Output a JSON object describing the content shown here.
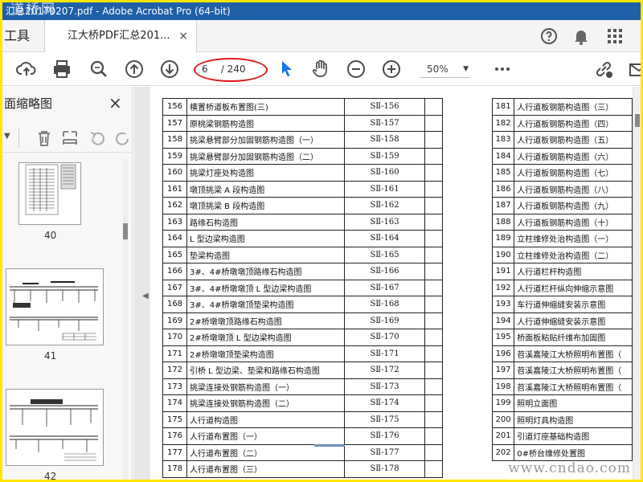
{
  "window": {
    "title": "汇总20170207.pdf - Adobe Acrobat Pro (64-bit)",
    "watermark": "道桥网"
  },
  "tabs": {
    "tools_label": "工具",
    "doc_label": "江大桥PDF汇总201...",
    "close": "×"
  },
  "toolbar": {
    "page_current": "6",
    "page_total": "/ 240",
    "zoom_value": "50%"
  },
  "left_panel": {
    "title": "面缩略图",
    "close": "×",
    "thumbs": [
      {
        "label": "40"
      },
      {
        "label": "41"
      },
      {
        "label": "42"
      }
    ]
  },
  "document": {
    "left_rows": [
      {
        "n": "156",
        "name": "横置桥道板布置图(三)",
        "code": "SⅡ-156"
      },
      {
        "n": "157",
        "name": "原桃梁钢筋构造图",
        "code": "SⅡ-157"
      },
      {
        "n": "158",
        "name": "挑梁悬臂部分加固钢筋构造图（一）",
        "code": "SⅡ-158"
      },
      {
        "n": "159",
        "name": "挑梁悬臂部分加固钢筋构造图（二）",
        "code": "SⅡ-159"
      },
      {
        "n": "160",
        "name": "挑梁灯座处构造图",
        "code": "SⅡ-160"
      },
      {
        "n": "161",
        "name": "墩顶挑梁 A 段构造图",
        "code": "SⅡ-161"
      },
      {
        "n": "162",
        "name": "墩顶挑梁 B 段构造图",
        "code": "SⅡ-162"
      },
      {
        "n": "163",
        "name": "路缘石构造图",
        "code": "SⅡ-163"
      },
      {
        "n": "164",
        "name": "L 型边梁构造图",
        "code": "SⅡ-164"
      },
      {
        "n": "165",
        "name": "垫梁构造图",
        "code": "SⅡ-165"
      },
      {
        "n": "166",
        "name": "3#、4#桥墩墩顶路缘石构造图",
        "code": "SⅡ-166"
      },
      {
        "n": "167",
        "name": "3#、4#桥墩墩顶 L 型边梁构造图",
        "code": "SⅡ-167"
      },
      {
        "n": "168",
        "name": "3#、4#桥墩墩顶垫梁构造图",
        "code": "SⅡ-168"
      },
      {
        "n": "169",
        "name": "2#桥墩墩顶路缘石构造图",
        "code": "SⅡ-169"
      },
      {
        "n": "170",
        "name": "2#桥墩墩顶 L 型边梁构造图",
        "code": "SⅡ-170"
      },
      {
        "n": "171",
        "name": "2#桥墩墩顶垫梁构造图",
        "code": "SⅡ-171"
      },
      {
        "n": "172",
        "name": "引桥 L 型边梁、垫梁和路缘石构造图",
        "code": "SⅡ-172"
      },
      {
        "n": "173",
        "name": "挑梁连接处钢筋构造图（一）",
        "code": "SⅡ-173"
      },
      {
        "n": "174",
        "name": "挑梁连接处钢筋构造图（二）",
        "code": "SⅡ-174"
      },
      {
        "n": "175",
        "name": "人行道构造图",
        "code": "SⅡ-175"
      },
      {
        "n": "176",
        "name": "人行道布置图（一）",
        "code": "SⅡ-176"
      },
      {
        "n": "177",
        "name": "人行道布置图（二）",
        "code": "SⅡ-177"
      },
      {
        "n": "178",
        "name": "人行道布置图（三）",
        "code": "SⅡ-178"
      }
    ],
    "right_rows": [
      {
        "n": "181",
        "name": "人行道板钢筋构造图（三）"
      },
      {
        "n": "182",
        "name": "人行道板钢筋构造图（四）"
      },
      {
        "n": "183",
        "name": "人行道板钢筋构造图（五）"
      },
      {
        "n": "184",
        "name": "人行道板钢筋构造图（六）"
      },
      {
        "n": "185",
        "name": "人行道板钢筋构造图（七）"
      },
      {
        "n": "186",
        "name": "人行道板钢筋构造图（八）"
      },
      {
        "n": "187",
        "name": "人行道板钢筋构造图（九）"
      },
      {
        "n": "188",
        "name": "人行道板钢筋构造图（十）"
      },
      {
        "n": "189",
        "name": "立柱维修处治构造图（一）"
      },
      {
        "n": "190",
        "name": "立柱维修处治构造图（二）"
      },
      {
        "n": "191",
        "name": "人行道栏杆构造图"
      },
      {
        "n": "192",
        "name": "人行道栏杆纵向伸缩示意图"
      },
      {
        "n": "193",
        "name": "车行道伸缩缝安装示意图"
      },
      {
        "n": "194",
        "name": "人行道伸缩缝安装示意图"
      },
      {
        "n": "195",
        "name": "桥面板粘贴纤维布加固图"
      },
      {
        "n": "196",
        "name": "苕溪嘉陵江大桥照明布置图（"
      },
      {
        "n": "197",
        "name": "苕溪嘉陵江大桥照明布置图（"
      },
      {
        "n": "198",
        "name": "苕溪嘉陵江大桥照明布置图（"
      },
      {
        "n": "199",
        "name": "照明立面图"
      },
      {
        "n": "200",
        "name": "照明灯具构造图"
      },
      {
        "n": "201",
        "name": "引道灯座基础构造图"
      },
      {
        "n": "202",
        "name": "0#桥台维修处置图"
      }
    ],
    "watermark": "www.cndao.com"
  }
}
